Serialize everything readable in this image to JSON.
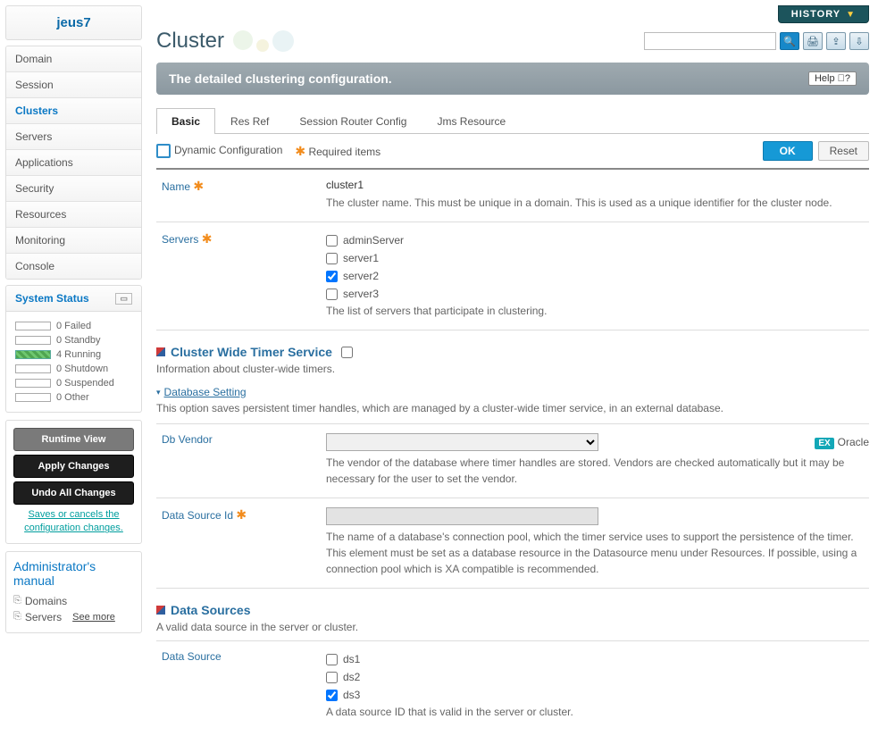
{
  "sidebar": {
    "header": "jeus7",
    "nav": [
      "Domain",
      "Session",
      "Clusters",
      "Servers",
      "Applications",
      "Security",
      "Resources",
      "Monitoring",
      "Console"
    ],
    "active_index": 2,
    "system_status_title": "System Status",
    "status": [
      {
        "count": 0,
        "label": "Failed",
        "green": false
      },
      {
        "count": 0,
        "label": "Standby",
        "green": false
      },
      {
        "count": 4,
        "label": "Running",
        "green": true
      },
      {
        "count": 0,
        "label": "Shutdown",
        "green": false
      },
      {
        "count": 0,
        "label": "Suspended",
        "green": false
      },
      {
        "count": 0,
        "label": "Other",
        "green": false
      }
    ],
    "runtime_view": "Runtime View",
    "apply_changes": "Apply Changes",
    "undo_changes": "Undo All Changes",
    "save_cancel_note": "Saves or cancels the configuration changes.",
    "manual_title": "Administrator's manual",
    "manual_links": [
      "Domains",
      "Servers"
    ],
    "see_more": "See more"
  },
  "page": {
    "history": "HISTORY",
    "title": "Cluster",
    "banner": "The detailed clustering configuration.",
    "help": "Help",
    "tabs": [
      "Basic",
      "Res Ref",
      "Session Router Config",
      "Jms Resource"
    ],
    "active_tab": 0,
    "legend_dynamic": "Dynamic Configuration",
    "legend_required": "Required items",
    "ok": "OK",
    "reset": "Reset"
  },
  "form": {
    "name_label": "Name",
    "name_value": "cluster1",
    "name_desc": "The cluster name. This must be unique in a domain. This is used as a unique identifier for the cluster node.",
    "servers_label": "Servers",
    "servers_options": [
      {
        "label": "adminServer",
        "checked": false
      },
      {
        "label": "server1",
        "checked": false
      },
      {
        "label": "server2",
        "checked": true
      },
      {
        "label": "server3",
        "checked": false
      }
    ],
    "servers_desc": "The list of servers that participate in clustering.",
    "timer_title": "Cluster Wide Timer Service",
    "timer_desc": "Information about cluster-wide timers.",
    "db_setting_link": "Database Setting",
    "db_setting_desc": "This option saves persistent timer handles, which are managed by a cluster-wide timer service, in an external database.",
    "db_vendor_label": "Db Vendor",
    "db_vendor_example": "Oracle",
    "db_vendor_desc": "The vendor of the database where timer handles are stored. Vendors are checked automatically but it may be necessary for the user to set the vendor.",
    "ds_id_label": "Data Source Id",
    "ds_id_desc": "The name of a database's connection pool, which the timer service uses to support the persistence of the timer. This element must be set as a database resource in the Datasource menu under Resources. If possible, using a connection pool which is XA compatible is recommended.",
    "ds_title": "Data Sources",
    "ds_desc": "A valid data source in the server or cluster.",
    "ds_label": "Data Source",
    "ds_options": [
      {
        "label": "ds1",
        "checked": false
      },
      {
        "label": "ds2",
        "checked": false
      },
      {
        "label": "ds3",
        "checked": true
      }
    ],
    "ds_field_desc": "A data source ID that is valid in the server or cluster."
  }
}
